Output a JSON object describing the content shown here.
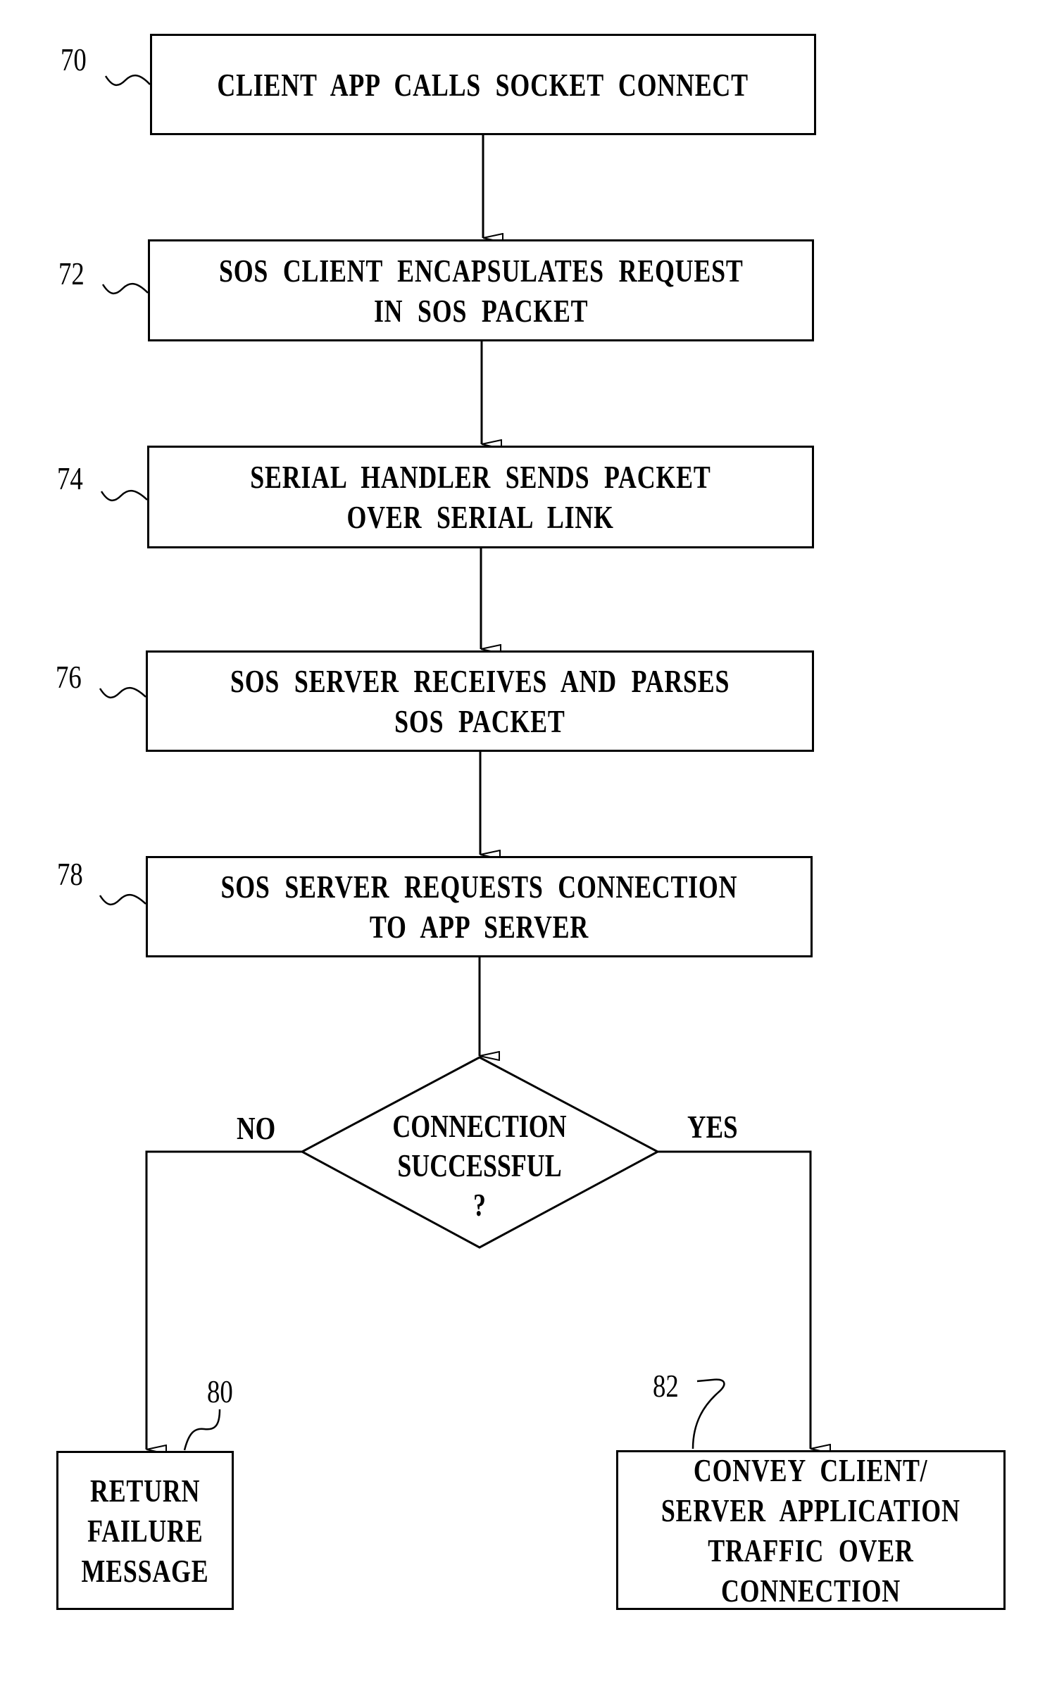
{
  "diagram": {
    "type": "flowchart",
    "steps": [
      {
        "ref": "70",
        "lines": [
          "CLIENT  APP  CALLS  SOCKET  CONNECT"
        ]
      },
      {
        "ref": "72",
        "lines": [
          "SOS  CLIENT  ENCAPSULATES  REQUEST",
          "IN  SOS  PACKET"
        ]
      },
      {
        "ref": "74",
        "lines": [
          "SERIAL  HANDLER  SENDS  PACKET",
          "OVER  SERIAL  LINK"
        ]
      },
      {
        "ref": "76",
        "lines": [
          "SOS  SERVER  RECEIVES  AND  PARSES",
          "SOS  PACKET"
        ]
      },
      {
        "ref": "78",
        "lines": [
          "SOS  SERVER  REQUESTS  CONNECTION",
          "TO  APP  SERVER"
        ]
      }
    ],
    "decision": {
      "lines": [
        "CONNECTION",
        "SUCCESSFUL",
        "?"
      ],
      "no_label": "NO",
      "yes_label": "YES"
    },
    "outcomes": {
      "failure": {
        "ref": "80",
        "lines": [
          "RETURN",
          "FAILURE",
          "MESSAGE"
        ]
      },
      "success": {
        "ref": "82",
        "lines": [
          "CONVEY  CLIENT/",
          "SERVER  APPLICATION",
          "TRAFFIC  OVER",
          "CONNECTION"
        ]
      }
    }
  }
}
